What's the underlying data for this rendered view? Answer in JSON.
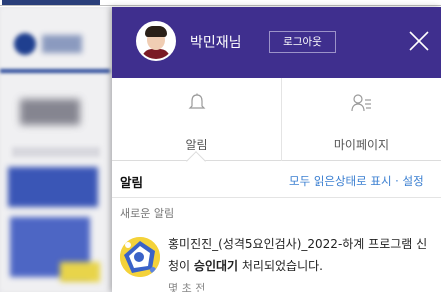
{
  "colors": {
    "header_bg": "#3f2f8e",
    "link_blue": "#3b7fd1",
    "page_bg_blur": "#e6e6ea"
  },
  "header": {
    "user_name": "박민재님",
    "logout_label": "로그아웃",
    "close_icon": "close-icon",
    "avatar": "user-avatar"
  },
  "nav": {
    "items": [
      {
        "label": "알림",
        "icon": "bell-icon"
      },
      {
        "label": "마이페이지",
        "icon": "user-list-icon"
      }
    ]
  },
  "section": {
    "title": "알림",
    "actions": "모두 읽은상태로 표시 · 설정"
  },
  "notifications": {
    "new_label": "새로운 알림",
    "items": [
      {
        "text_before": "홍미진진_(성격5요인검사)_2022-하계 프로그램 신청이 ",
        "text_bold": "승인대기",
        "text_after": " 처리되었습니다.",
        "time": "몇 초 전",
        "thumb": "program-thumbnail"
      }
    ]
  }
}
